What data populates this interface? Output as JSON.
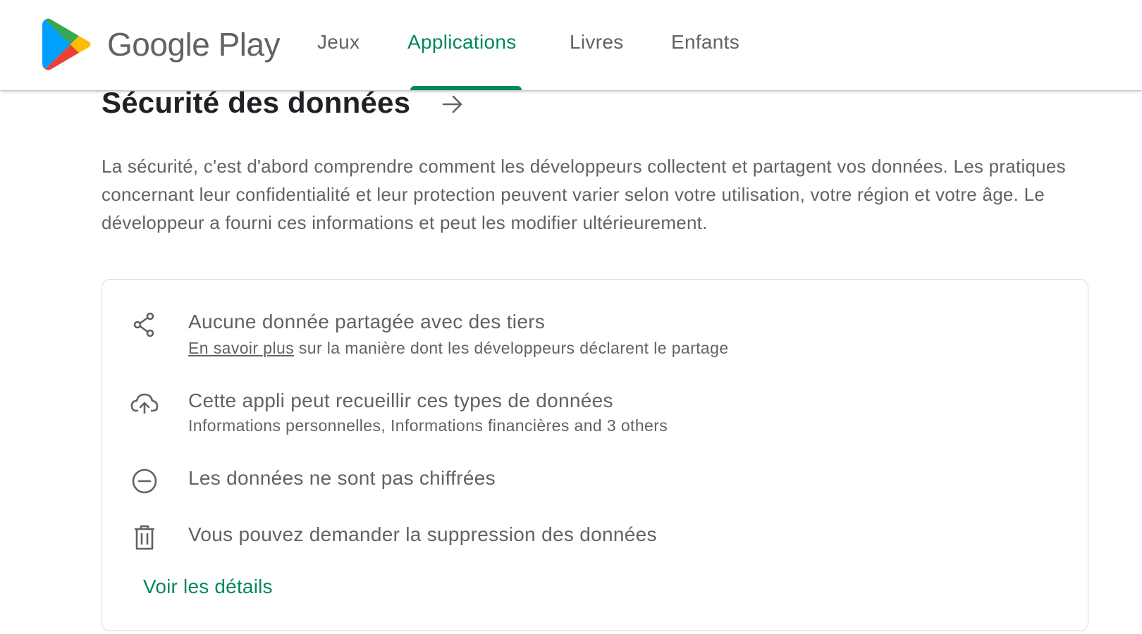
{
  "header": {
    "brand": "Google Play",
    "nav": [
      {
        "label": "Jeux",
        "active": false
      },
      {
        "label": "Applications",
        "active": true
      },
      {
        "label": "Livres",
        "active": false
      },
      {
        "label": "Enfants",
        "active": false
      }
    ]
  },
  "section": {
    "title": "Sécurité des données",
    "arrow_icon": "arrow-right-icon",
    "description": "La sécurité, c'est d'abord comprendre comment les développeurs collectent et partagent vos données. Les pratiques concernant leur confidentialité et leur protection peuvent varier selon votre utilisation, votre région et votre âge. Le développeur a fourni ces informations et peut les modifier ultérieurement."
  },
  "card": {
    "items": [
      {
        "icon": "share-icon",
        "title": "Aucune donnée partagée avec des tiers",
        "link": "En savoir plus",
        "subtitle": " sur la manière dont les développeurs déclarent le partage"
      },
      {
        "icon": "cloud-upload-icon",
        "title": "Cette appli peut recueillir ces types de données",
        "subtitle": "Informations personnelles, Informations financières and 3 others"
      },
      {
        "icon": "no-encryption-icon",
        "title": "Les données ne sont pas chiffrées"
      },
      {
        "icon": "trash-icon",
        "title": "Vous pouvez demander la suppression des données"
      }
    ],
    "details_link": "Voir les détails"
  },
  "colors": {
    "accent": "#01875f",
    "text_primary": "#202124",
    "text_secondary": "#5f6368",
    "border": "#dadce0"
  }
}
